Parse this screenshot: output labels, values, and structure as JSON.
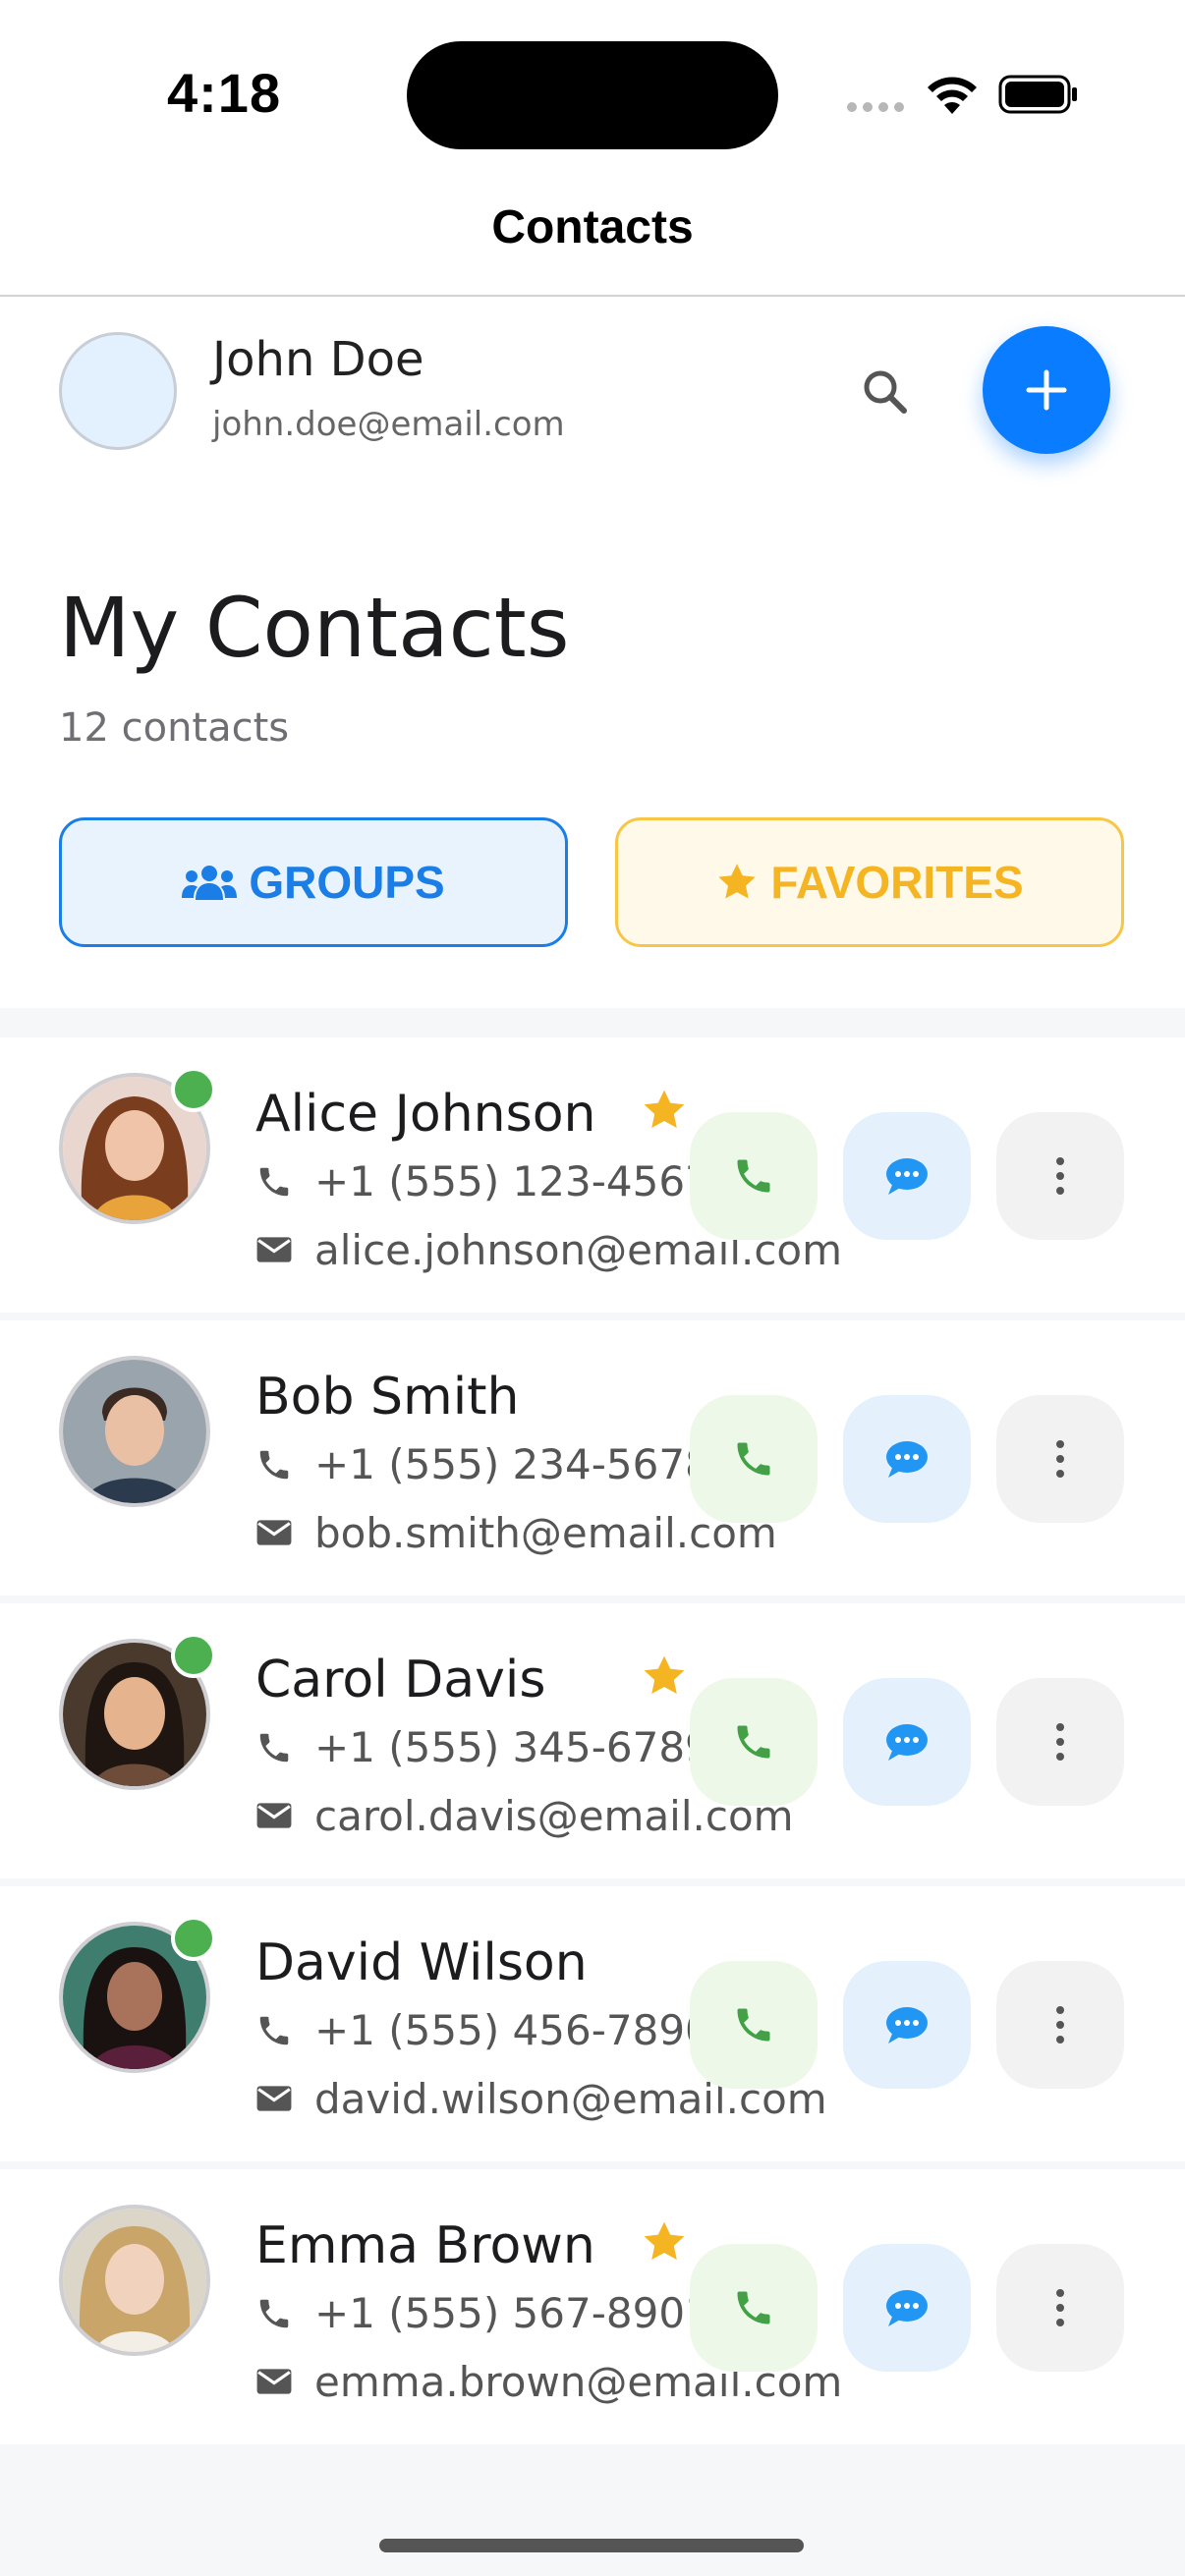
{
  "status_bar": {
    "time": "4:18"
  },
  "nav": {
    "title": "Contacts"
  },
  "user": {
    "name": "John Doe",
    "email": "john.doe@email.com"
  },
  "section": {
    "title": "My Contacts",
    "count": "12 contacts"
  },
  "filters": {
    "groups_label": "GROUPS",
    "favorites_label": "FAVORITES"
  },
  "colors": {
    "accent": "#0a7cff",
    "online": "#4caf50",
    "favorite": "#f5b523",
    "call": "#43a047",
    "message": "#2196f3"
  },
  "contacts": [
    {
      "name": "Alice Johnson",
      "phone": "+1 (555) 123-4567",
      "email": "alice.johnson@email.com",
      "favorite": true,
      "online": true
    },
    {
      "name": "Bob Smith",
      "phone": "+1 (555) 234-5678",
      "email": "bob.smith@email.com",
      "favorite": false,
      "online": false
    },
    {
      "name": "Carol Davis",
      "phone": "+1 (555) 345-6789",
      "email": "carol.davis@email.com",
      "favorite": true,
      "online": true
    },
    {
      "name": "David Wilson",
      "phone": "+1 (555) 456-7890",
      "email": "david.wilson@email.com",
      "favorite": false,
      "online": true
    },
    {
      "name": "Emma Brown",
      "phone": "+1 (555) 567-8901",
      "email": "emma.brown@email.com",
      "favorite": true,
      "online": false
    }
  ]
}
